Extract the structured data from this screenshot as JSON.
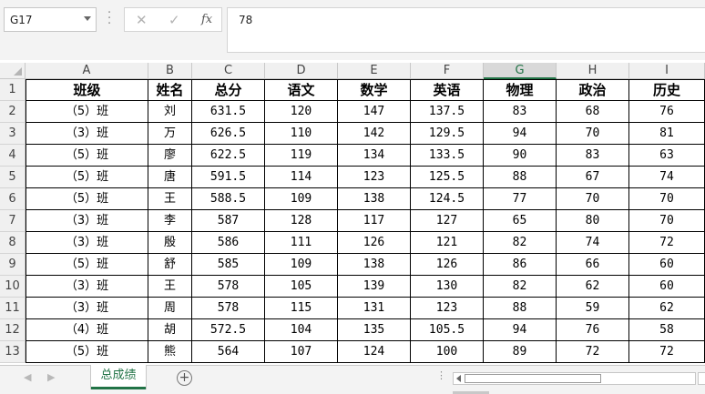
{
  "formula_bar": {
    "name_box": "G17",
    "cancel_icon": "✕",
    "enter_icon": "✓",
    "fx_label": "fx",
    "value": "78"
  },
  "columns": [
    "A",
    "B",
    "C",
    "D",
    "E",
    "F",
    "G",
    "H",
    "I"
  ],
  "selected_column": "G",
  "headers": [
    "班级",
    "姓名",
    "总分",
    "语文",
    "数学",
    "英语",
    "物理",
    "政治",
    "历史"
  ],
  "rows": [
    [
      "（5）班",
      "刘",
      "631.5",
      "120",
      "147",
      "137.5",
      "83",
      "68",
      "76"
    ],
    [
      "（3）班",
      "万",
      "626.5",
      "110",
      "142",
      "129.5",
      "94",
      "70",
      "81"
    ],
    [
      "（5）班",
      "廖",
      "622.5",
      "119",
      "134",
      "133.5",
      "90",
      "83",
      "63"
    ],
    [
      "（5）班",
      "唐",
      "591.5",
      "114",
      "123",
      "125.5",
      "88",
      "67",
      "74"
    ],
    [
      "（5）班",
      "王",
      "588.5",
      "109",
      "138",
      "124.5",
      "77",
      "70",
      "70"
    ],
    [
      "（3）班",
      "李",
      "587",
      "128",
      "117",
      "127",
      "65",
      "80",
      "70"
    ],
    [
      "（3）班",
      "殷",
      "586",
      "111",
      "126",
      "121",
      "82",
      "74",
      "72"
    ],
    [
      "（5）班",
      "舒",
      "585",
      "109",
      "138",
      "126",
      "86",
      "66",
      "60"
    ],
    [
      "（3）班",
      "王",
      "578",
      "105",
      "139",
      "130",
      "82",
      "62",
      "60"
    ],
    [
      "（3）班",
      "周",
      "578",
      "115",
      "131",
      "123",
      "88",
      "59",
      "62"
    ],
    [
      "（4）班",
      "胡",
      "572.5",
      "104",
      "135",
      "105.5",
      "94",
      "76",
      "58"
    ],
    [
      "（5）班",
      "熊",
      "564",
      "107",
      "124",
      "100",
      "89",
      "72",
      "72"
    ]
  ],
  "sheet_tabs": [
    {
      "label": "总成绩",
      "active": true
    }
  ],
  "add_sheet_icon": "+",
  "colors": {
    "accent": "#217346"
  }
}
